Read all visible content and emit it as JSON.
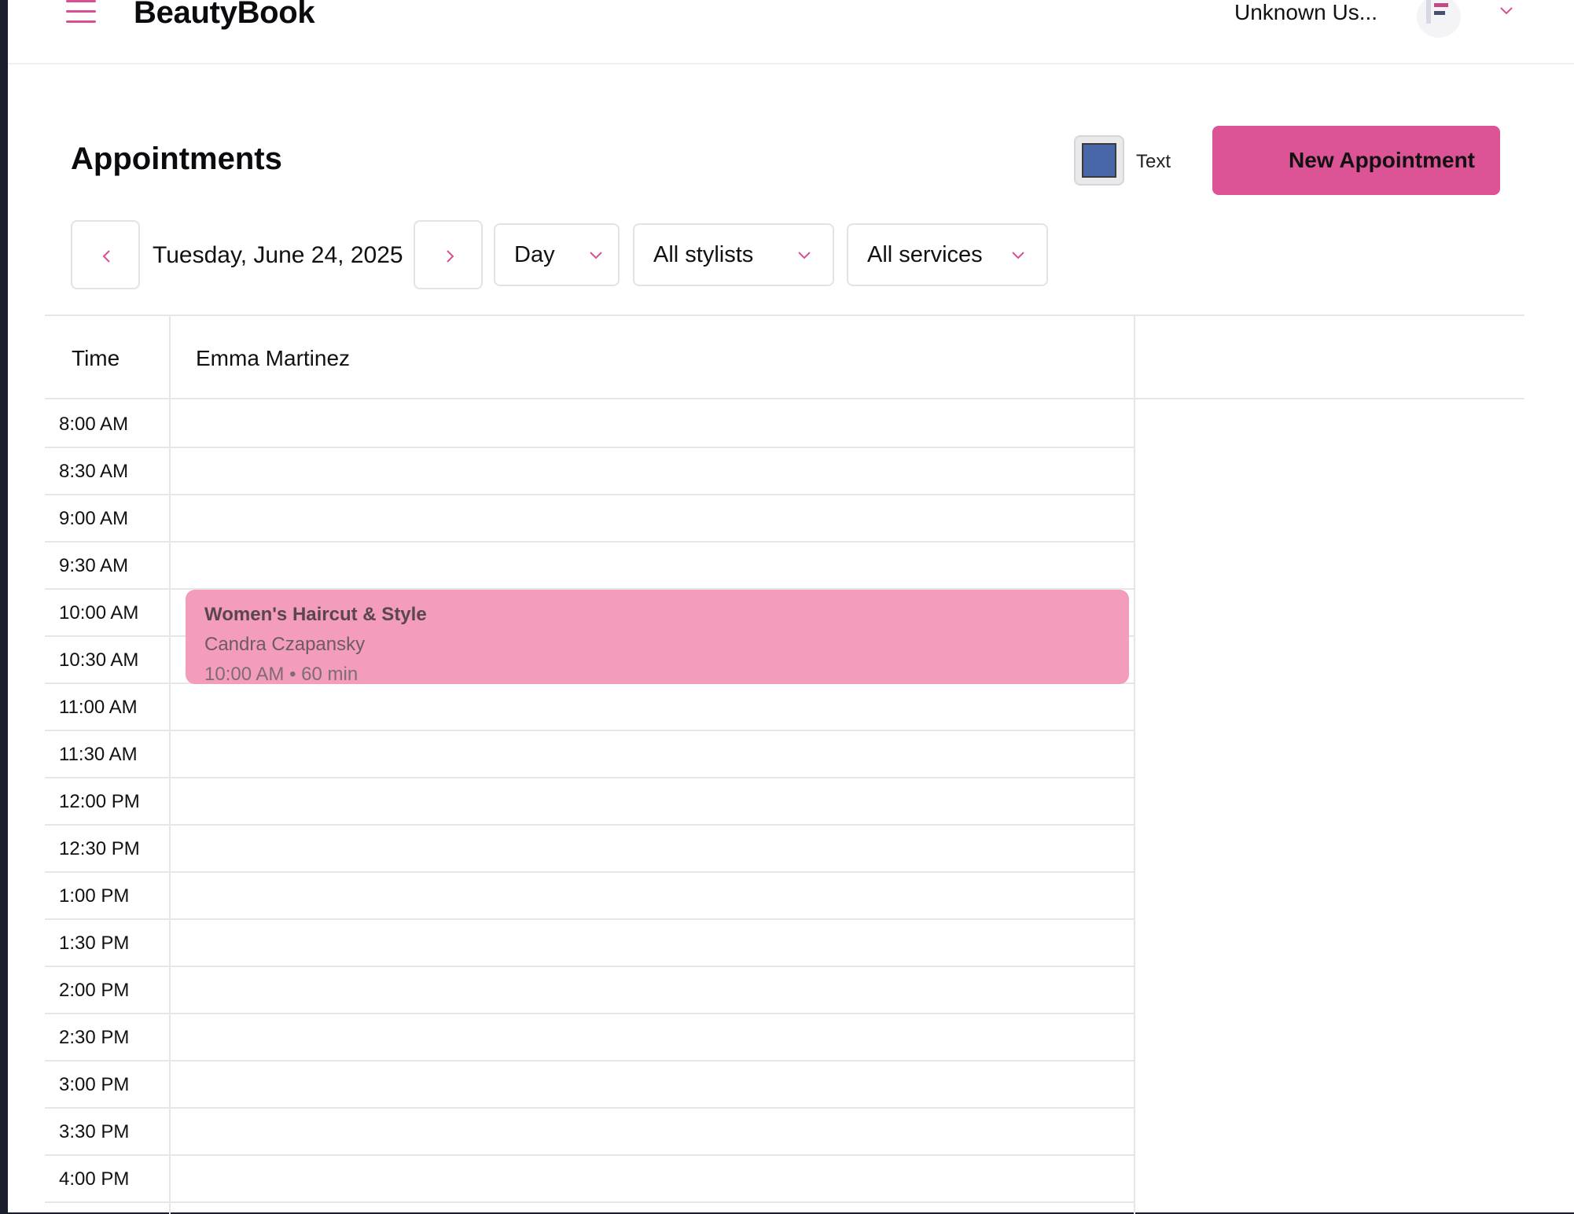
{
  "app": {
    "brand": "BeautyBook",
    "user_name": "Unknown Us...",
    "accent_color": "#dc5396"
  },
  "header": {
    "title": "Appointments",
    "color_swatch": "#4866a8",
    "color_label": "Text",
    "new_button": "New Appointment"
  },
  "filters": {
    "date": "Tuesday, June 24, 2025",
    "view": "Day",
    "stylists": "All stylists",
    "services": "All services"
  },
  "calendar": {
    "time_header": "Time",
    "stylist": "Emma Martinez",
    "slots": [
      "8:00 AM",
      "8:30 AM",
      "9:00 AM",
      "9:30 AM",
      "10:00 AM",
      "10:30 AM",
      "11:00 AM",
      "11:30 AM",
      "12:00 PM",
      "12:30 PM",
      "1:00 PM",
      "1:30 PM",
      "2:00 PM",
      "2:30 PM",
      "3:00 PM",
      "3:30 PM",
      "4:00 PM"
    ],
    "appointment": {
      "service": "Women's Haircut & Style",
      "client": "Candra Czapansky",
      "meta": "10:00 AM • 60 min",
      "color": "#f39cbb"
    }
  }
}
